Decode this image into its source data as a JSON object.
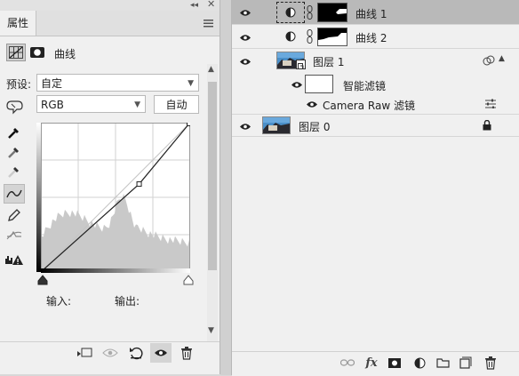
{
  "properties": {
    "tab_label": "属性",
    "panel_type_label": "曲线",
    "preset_label": "预设:",
    "preset_value": "自定",
    "channel_value": "RGB",
    "auto_button": "自动",
    "input_label": "输入:",
    "output_label": "输出:"
  },
  "curve": {
    "points": [
      [
        0,
        0
      ],
      [
        0.66,
        0.59
      ],
      [
        1,
        1
      ]
    ]
  },
  "layers": {
    "rows": [
      {
        "name": "曲线 1",
        "selected": true
      },
      {
        "name": "曲线 2",
        "selected": false
      },
      {
        "name": "图层 1",
        "selected": false
      },
      {
        "name": "智能滤镜",
        "selected": false
      },
      {
        "name": "Camera Raw 滤镜",
        "selected": false
      },
      {
        "name": "图层 0",
        "selected": false
      }
    ]
  },
  "icons": {
    "eye": "eye-icon",
    "lock": "lock-icon",
    "link": "link-icon",
    "adjust": "adjustment-icon",
    "fx": "fx"
  },
  "colors": {
    "selected_row": "#b9b9b9",
    "panel_bg": "#f0f0f0"
  }
}
